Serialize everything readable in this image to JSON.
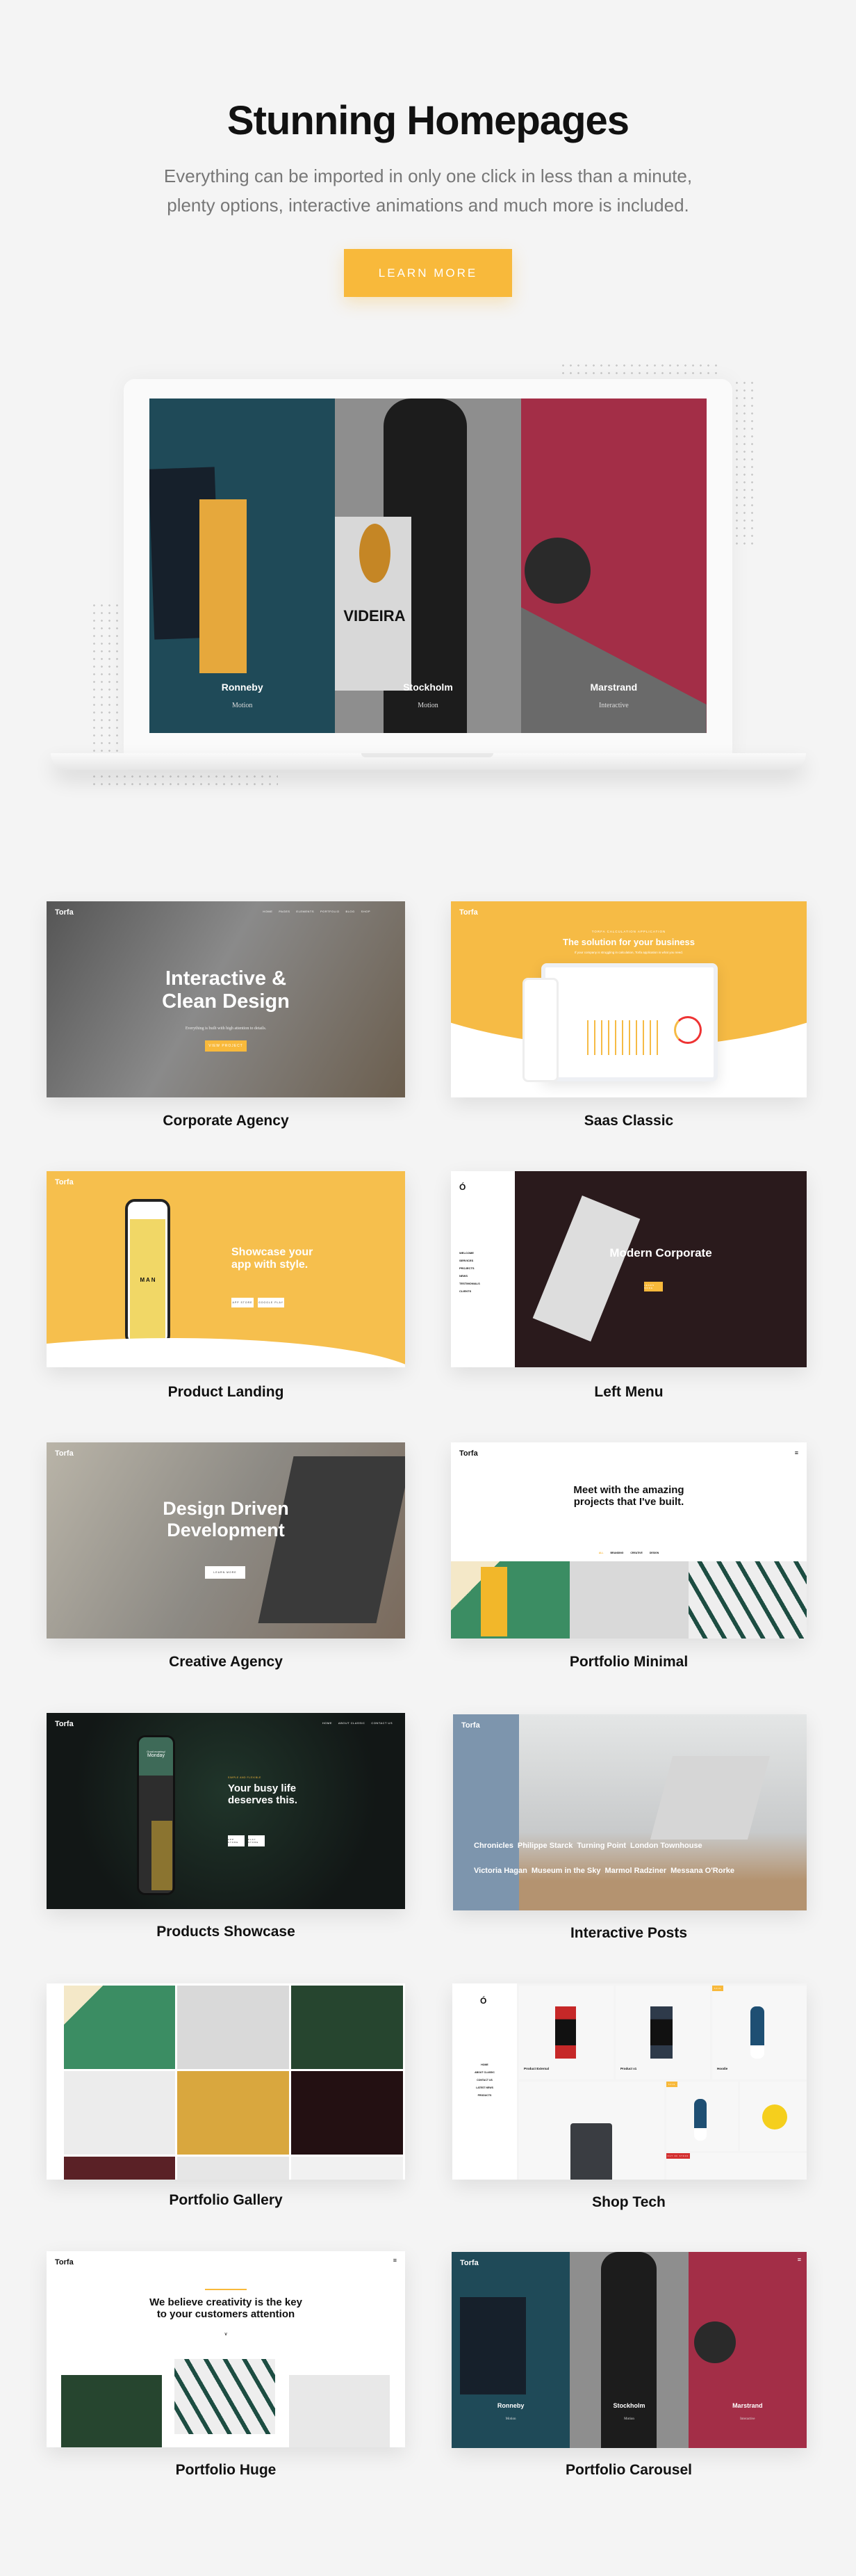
{
  "header": {
    "title": "Stunning Homepages",
    "subtitle_line1": "Everything can be imported in only one click in less than a minute,",
    "subtitle_line2": "plenty options, interactive animations and much more is included.",
    "button": "LEARN MORE"
  },
  "colors": {
    "accent": "#f8b93b",
    "background": "#f4f4f4"
  },
  "laptop": {
    "panels": [
      {
        "name": "Ronneby",
        "sub": "Motion"
      },
      {
        "name": "Stockholm",
        "sub": "Motion"
      },
      {
        "name": "Marstrand",
        "sub": "Interactive"
      }
    ]
  },
  "cards": [
    {
      "label": "Corporate Agency",
      "logo": "Torfa",
      "nav": [
        "HOME",
        "PAGES",
        "ELEMENTS",
        "PORTFOLIO",
        "BLOG",
        "SHOP"
      ],
      "headline1": "Interactive &",
      "headline2": "Clean Design",
      "sub": "Everything is built with high attention to details.",
      "button": "VIEW PROJECT"
    },
    {
      "label": "Saas Classic",
      "logo": "Torfa",
      "kicker": "TORFA CALCULATION APPLICATION",
      "headline": "The solution for your business",
      "sub": "If your company is struggling in calculation, Torfa application is what you need."
    },
    {
      "label": "Product Landing",
      "logo": "Torfa",
      "phone_text": "M A N",
      "headline1": "Showcase your",
      "headline2": "app with style.",
      "button1": "APP STORE",
      "button2": "GOOGLE PLAY"
    },
    {
      "label": "Left Menu",
      "menu": [
        "WELCOME",
        "SERVICES",
        "PROJECTS",
        "NEWS",
        "TESTIMONIALS",
        "CLIENTS"
      ],
      "headline": "Modern Corporate",
      "button": "LEARN MORE"
    },
    {
      "label": "Creative Agency",
      "logo": "Torfa",
      "headline1": "Design Driven",
      "headline2": "Development",
      "button": "LEARN MORE"
    },
    {
      "label": "Portfolio Minimal",
      "logo": "Torfa",
      "headline1": "Meet with the amazing",
      "headline2": "projects that I've built.",
      "filters": [
        "ALL",
        "BRANDING",
        "CREATIVE",
        "DESIGN"
      ]
    },
    {
      "label": "Products Showcase",
      "logo": "Torfa",
      "nav": [
        "HOME",
        "ABOUT CLASSIC",
        "CONTACT US"
      ],
      "phone_greeting": "Good morning!",
      "phone_day": "Monday",
      "kicker": "SIMPLE AND FLEXIBLE",
      "headline1": "Your busy life",
      "headline2": "deserves this.",
      "button1": "APP STORE",
      "button2": "PLAY STORE"
    },
    {
      "label": "Interactive Posts",
      "logo": "Torfa",
      "posts_row1": [
        "Chronicles",
        "Philippe Starck",
        "Turning Point",
        "London Townhouse"
      ],
      "posts_row2": [
        "Victoria Hagan",
        "Museum in the Sky",
        "Marmol Radziner",
        "Messana O'Rorke"
      ]
    },
    {
      "label": "Portfolio Gallery"
    },
    {
      "label": "Shop Tech",
      "menu": [
        "HOME",
        "ABOUT CLASSIC",
        "CONTACT US",
        "LATEST NEWS",
        "PRODUCTS"
      ],
      "products": [
        "Product External",
        "Product v1",
        "Hoodie"
      ],
      "badge_sale": "SALE",
      "badge_out": "OUT OF STOCK"
    },
    {
      "label": "Portfolio Huge",
      "logo": "Torfa",
      "headline1": "We believe creativity is the key",
      "headline2": "to your customers attention"
    },
    {
      "label": "Portfolio Carousel",
      "logo": "Torfa",
      "panels": [
        {
          "name": "Ronneby",
          "sub": "Motion"
        },
        {
          "name": "Stockholm",
          "sub": "Motion"
        },
        {
          "name": "Marstrand",
          "sub": "Interactive"
        }
      ]
    }
  ]
}
